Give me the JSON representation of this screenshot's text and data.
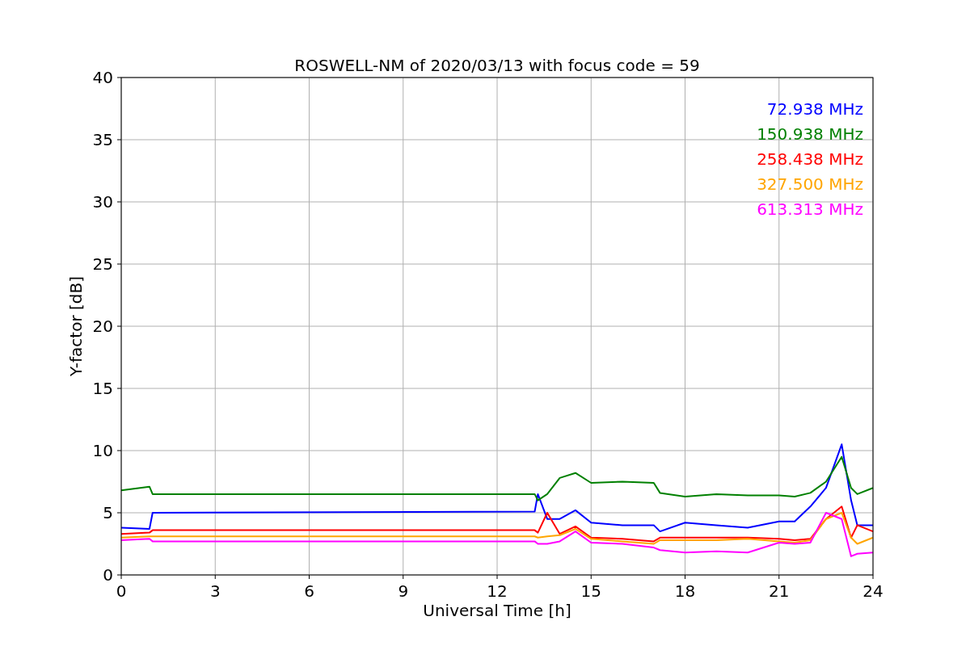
{
  "chart_data": {
    "type": "line",
    "title": "ROSWELL-NM of 2020/03/13 with focus code = 59",
    "xlabel": "Universal Time [h]",
    "ylabel": "Y-factor [dB]",
    "x": [
      0,
      0.9,
      1,
      13.2,
      13.3,
      13.6,
      14,
      14.5,
      15,
      16,
      17,
      17.2,
      18,
      19,
      20,
      21,
      21.5,
      22,
      22.5,
      23,
      23.3,
      23.5,
      24
    ],
    "series": [
      {
        "name": "72.938 MHz",
        "color": "#0000ff",
        "values": [
          3.8,
          3.7,
          5.0,
          5.1,
          6.5,
          4.5,
          4.5,
          5.2,
          4.2,
          4.0,
          4.0,
          3.5,
          4.2,
          4.0,
          3.8,
          4.3,
          4.3,
          5.5,
          7.0,
          10.5,
          6.0,
          4.0,
          4.0
        ]
      },
      {
        "name": "150.938 MHz",
        "color": "#008000",
        "values": [
          6.8,
          7.1,
          6.5,
          6.5,
          6.0,
          6.5,
          7.8,
          8.2,
          7.4,
          7.5,
          7.4,
          6.6,
          6.3,
          6.5,
          6.4,
          6.4,
          6.3,
          6.6,
          7.5,
          9.5,
          7.0,
          6.5,
          7.0
        ]
      },
      {
        "name": "258.438 MHz",
        "color": "#ff0000",
        "values": [
          3.3,
          3.4,
          3.6,
          3.6,
          3.4,
          5.0,
          3.3,
          3.9,
          3.0,
          2.9,
          2.7,
          3.0,
          3.0,
          3.0,
          3.0,
          2.9,
          2.8,
          2.9,
          4.5,
          5.5,
          3.0,
          4.0,
          3.5
        ]
      },
      {
        "name": "327.500 MHz",
        "color": "#ffa500",
        "values": [
          3.0,
          3.1,
          3.1,
          3.1,
          3.0,
          3.1,
          3.2,
          3.7,
          2.9,
          2.7,
          2.5,
          2.8,
          2.8,
          2.8,
          2.9,
          2.7,
          2.6,
          2.8,
          4.5,
          5.0,
          3.0,
          2.5,
          3.0
        ]
      },
      {
        "name": "613.313 MHz",
        "color": "#ff00ff",
        "values": [
          2.8,
          2.9,
          2.7,
          2.7,
          2.5,
          2.5,
          2.7,
          3.5,
          2.6,
          2.5,
          2.2,
          2.0,
          1.8,
          1.9,
          1.8,
          2.6,
          2.5,
          2.6,
          5.0,
          4.5,
          1.5,
          1.7,
          1.8
        ]
      }
    ],
    "grid": true,
    "xlim": [
      0,
      24
    ],
    "ylim": [
      0,
      40
    ],
    "xticks": [
      0,
      3,
      6,
      9,
      12,
      15,
      18,
      21,
      24
    ],
    "yticks": [
      0,
      5,
      10,
      15,
      20,
      25,
      30,
      35,
      40
    ]
  }
}
